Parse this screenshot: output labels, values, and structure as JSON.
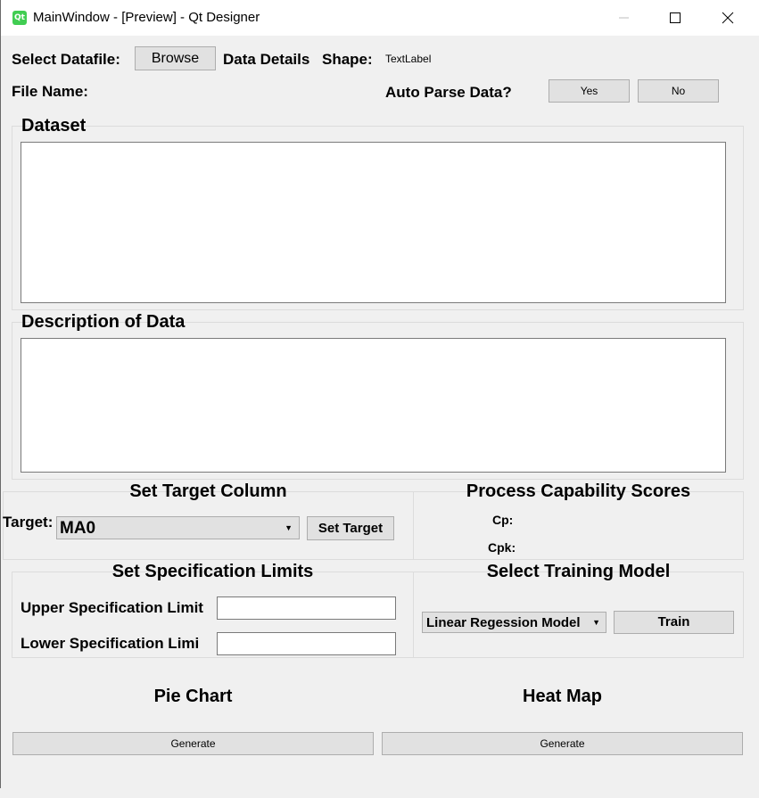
{
  "window": {
    "title": "MainWindow - [Preview] - Qt Designer",
    "icon": "qt-logo-icon",
    "icon_text": "Qt"
  },
  "top": {
    "select_datafile_label": "Select Datafile:",
    "browse_button": "Browse",
    "data_details_label": "Data Details",
    "shape_label": "Shape:",
    "shape_value": "TextLabel",
    "file_name_label": "File Name:",
    "auto_parse_label": "Auto Parse Data?",
    "yes_button": "Yes",
    "no_button": "No"
  },
  "dataset_group": {
    "title": "Dataset"
  },
  "description_group": {
    "title": "Description of Data"
  },
  "target_group": {
    "title": "Set Target Column",
    "target_label": "Target:",
    "target_value": "MA0",
    "set_target_button": "Set Target"
  },
  "capability_group": {
    "title": "Process Capability Scores",
    "cp_label": "Cp:",
    "cpk_label": "Cpk:"
  },
  "spec_group": {
    "title": "Set Specification Limits",
    "upper_label": "Upper Specification Limit",
    "lower_label": "Lower Specification Limi",
    "upper_value": "",
    "lower_value": ""
  },
  "model_group": {
    "title": "Select Training Model",
    "model_value": "Linear Regession Model",
    "train_button": "Train"
  },
  "pie_chart": {
    "title": "Pie Chart",
    "generate_button": "Generate"
  },
  "heat_map": {
    "title": "Heat Map",
    "generate_button": "Generate"
  }
}
